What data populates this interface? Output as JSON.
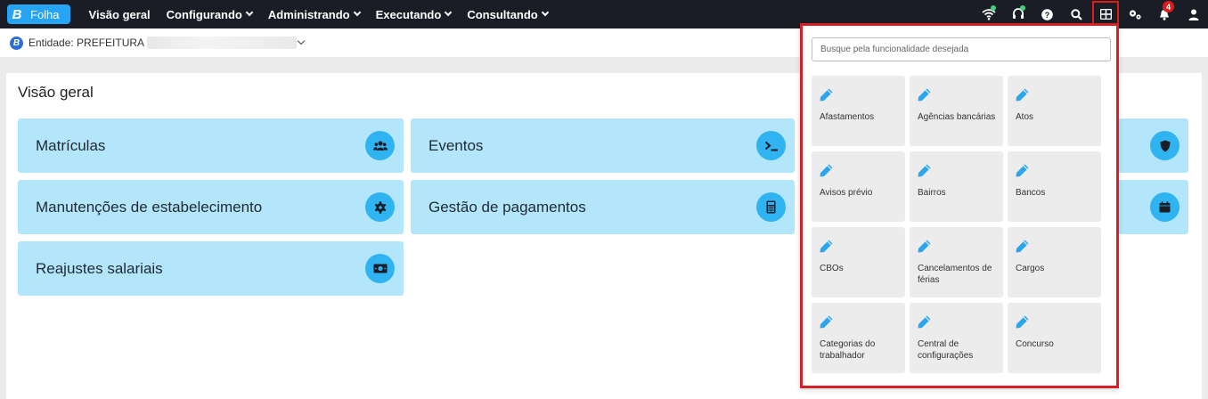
{
  "brand": {
    "logo": "B",
    "name": "Folha"
  },
  "menu": [
    {
      "label": "Visão geral",
      "has_dropdown": false
    },
    {
      "label": "Configurando",
      "has_dropdown": true
    },
    {
      "label": "Administrando",
      "has_dropdown": true
    },
    {
      "label": "Executando",
      "has_dropdown": true
    },
    {
      "label": "Consultando",
      "has_dropdown": true
    }
  ],
  "toolbar": {
    "icons": [
      "wifi-icon",
      "headset-icon",
      "help-icon",
      "search-icon",
      "apps-grid-icon",
      "settings-gears-icon",
      "bell-icon",
      "user-icon"
    ],
    "notification_count": "4"
  },
  "entity": {
    "logo": "B",
    "label": "Entidade: PREFEITURA"
  },
  "overview": {
    "title": "Visão geral",
    "cards": [
      {
        "label": "Matrículas",
        "icon": "users-icon"
      },
      {
        "label": "Eventos",
        "icon": "terminal-icon"
      },
      {
        "label": "",
        "icon": "shield-icon"
      },
      {
        "label": "Manutenções de estabelecimento",
        "icon": "gear-icon"
      },
      {
        "label": "Gestão de pagamentos",
        "icon": "calculator-icon"
      },
      {
        "label": "",
        "icon": "calendar-icon"
      },
      {
        "label": "Reajustes salariais",
        "icon": "money-icon"
      }
    ]
  },
  "functions_panel": {
    "search_placeholder": "Busque pela funcionalidade desejada",
    "items": [
      {
        "label": "Afastamentos"
      },
      {
        "label": "Agências bancárias"
      },
      {
        "label": "Atos"
      },
      {
        "label": "Avisos prévio"
      },
      {
        "label": "Bairros"
      },
      {
        "label": "Bancos"
      },
      {
        "label": "CBOs"
      },
      {
        "label": "Cancelamentos de férias"
      },
      {
        "label": "Cargos"
      },
      {
        "label": "Categorias do trabalhador"
      },
      {
        "label": "Central de configurações"
      },
      {
        "label": "Concurso"
      }
    ]
  },
  "colors": {
    "navbar": "#1a1d26",
    "brand_accent": "#27a4f3",
    "card_bg": "#b3e6fb",
    "card_icon_bg": "#2fb3f1",
    "highlight_border": "#d81f26",
    "pencil": "#2aa6ee"
  }
}
